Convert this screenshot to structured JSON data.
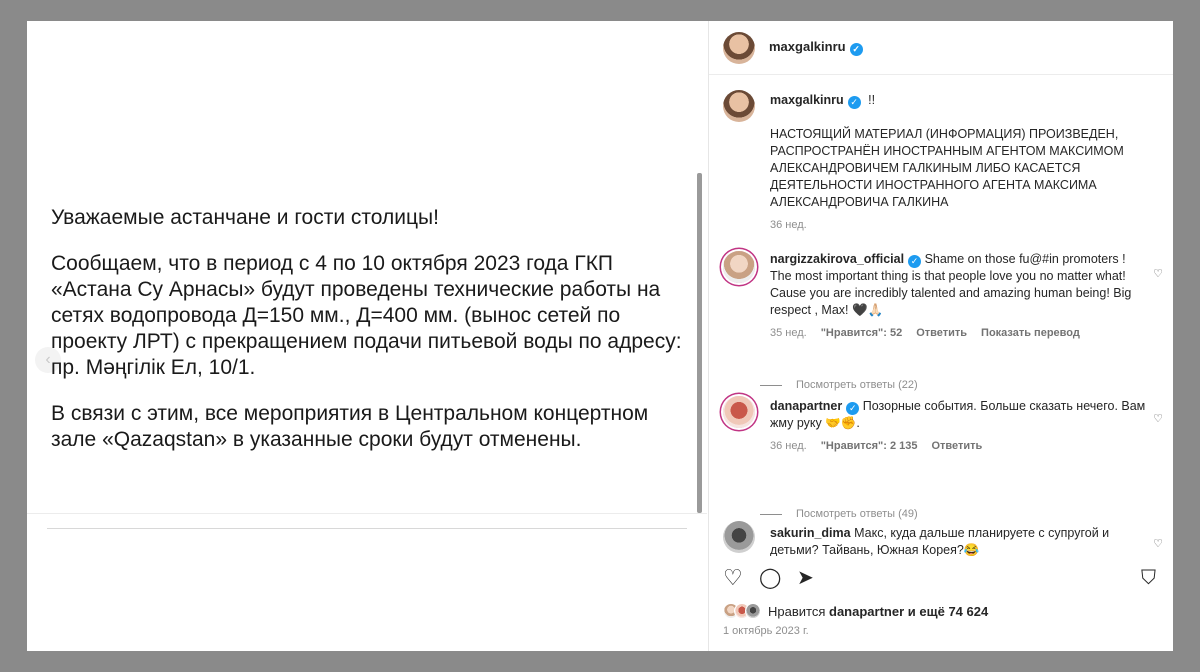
{
  "post": {
    "paragraph1": "Уважаемые астанчане и гости столицы!",
    "paragraph2": "Сообщаем, что в период с 4 по 10 октября 2023 года ГКП «Астана Су Арнасы» будут проведены технические работы на сетях водопровода Д=150 мм., Д=400 мм. (вынос сетей по проекту ЛРТ) с прекращением подачи питьевой воды по адресу: пр. Мәңгілік Ел, 10/1.",
    "paragraph3": "В связи с этим, все мероприятия в Центральном концертном зале «Qazaqstan» в указанные сроки будут отменены."
  },
  "header": {
    "username": "maxgalkinru"
  },
  "caption": {
    "username": "maxgalkinru",
    "text_short": "!!",
    "text": "НАСТОЯЩИЙ МАТЕРИАЛ (ИНФОРМАЦИЯ) ПРОИЗВЕДЕН, РАСПРОСТРАНЁН ИНОСТРАННЫМ АГЕНТОМ МАКСИМОМ АЛЕКСАНДРОВИЧЕМ ГАЛКИНЫМ ЛИБО КАСАЕТСЯ ДЕЯТЕЛЬНОСТИ ИНОСТРАННОГО АГЕНТА МАКСИМА АЛЕКСАНДРОВИЧА ГАЛКИНА",
    "time": "36 нед."
  },
  "comments": [
    {
      "username": "nargizzakirova_official",
      "text": "Shame on those fu@#in promoters ! The most important thing is that people love you no matter what! Cause you are incredibly talented and amazing human being! Big respect , Max! 🖤🙏🏻",
      "time": "35 нед.",
      "likes": "\"Нравится\": 52",
      "reply": "Ответить",
      "translate": "Показать перевод",
      "view_replies": "Посмотреть ответы (22)"
    },
    {
      "username": "danapartner",
      "text": "Позорные события. Больше сказать нечего. Вам жму руку 🤝✊.",
      "time": "36 нед.",
      "likes": "\"Нравится\": 2 135",
      "reply": "Ответить",
      "view_replies": "Посмотреть ответы (49)"
    },
    {
      "username": "sakurin_dima",
      "text": "Макс, куда дальше планируете с супругой и детьми? Тайвань, Южная Корея?😂"
    }
  ],
  "likes_line": {
    "prefix": "Нравится",
    "user": "danapartner",
    "suffix": "и ещё",
    "count": "74 624"
  },
  "date": "1 октябрь 2023 г.",
  "icons": [
    "heart-icon",
    "comment-icon",
    "share-icon",
    "bookmark-icon",
    "verified-icon",
    "chevron-left-icon"
  ]
}
